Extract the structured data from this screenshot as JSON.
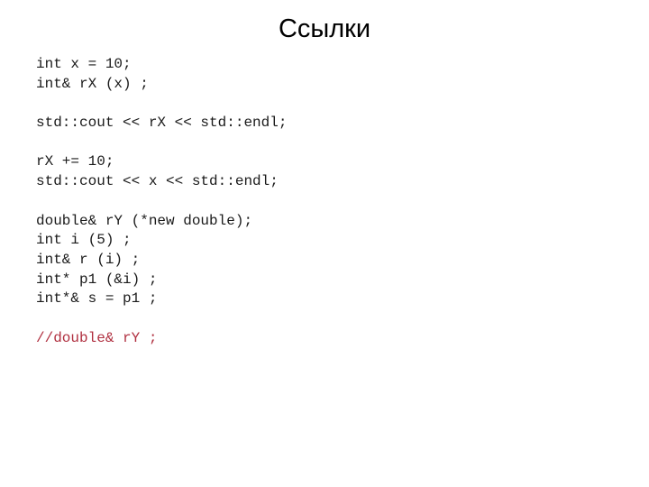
{
  "slide": {
    "title": "Ссылки",
    "code_lines": [
      {
        "text": "int x = 10;",
        "kind": "code"
      },
      {
        "text": "int& rX (x) ;",
        "kind": "code"
      },
      {
        "text": "",
        "kind": "blank"
      },
      {
        "text": "std::cout << rX << std::endl;",
        "kind": "code"
      },
      {
        "text": "",
        "kind": "blank"
      },
      {
        "text": "rX += 10;",
        "kind": "code"
      },
      {
        "text": "std::cout << x << std::endl;",
        "kind": "code"
      },
      {
        "text": "",
        "kind": "blank"
      },
      {
        "text": "double& rY (*new double);",
        "kind": "code"
      },
      {
        "text": "int i (5) ;",
        "kind": "code"
      },
      {
        "text": "int& r (i) ;",
        "kind": "code"
      },
      {
        "text": "int* p1 (&i) ;",
        "kind": "code"
      },
      {
        "text": "int*& s = p1 ;",
        "kind": "code"
      },
      {
        "text": "",
        "kind": "blank"
      },
      {
        "text": "//double& rY ;",
        "kind": "comment"
      }
    ]
  },
  "colors": {
    "text": "#1a1a1a",
    "comment": "#b03040",
    "background": "#ffffff"
  }
}
